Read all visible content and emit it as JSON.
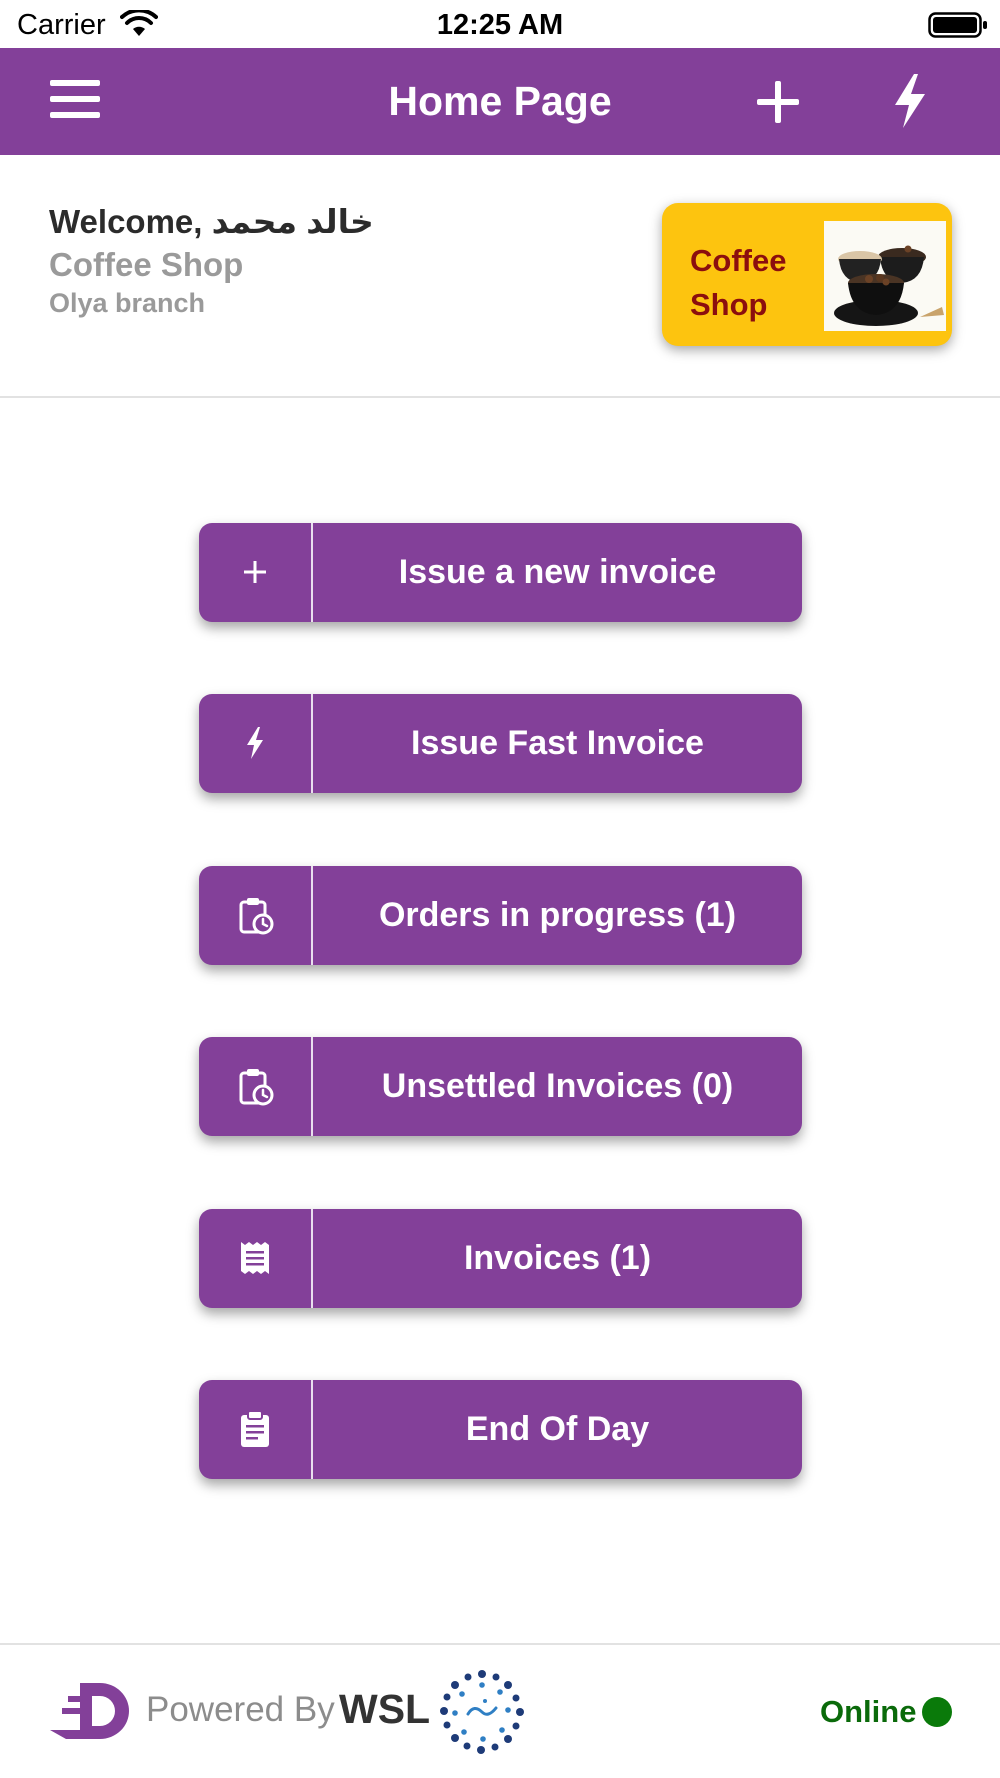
{
  "status_bar": {
    "carrier": "Carrier",
    "time": "12:25 AM",
    "icons": [
      "wifi-icon",
      "battery-icon"
    ]
  },
  "nav_bar": {
    "title": "Home Page",
    "icons": [
      "menu-icon",
      "add-icon",
      "flash-icon"
    ],
    "background_color": "#834099"
  },
  "welcome": {
    "greeting": "Welcome, خالد محمد",
    "shop_name": "Coffee Shop",
    "branch": "Olya branch"
  },
  "shop_logo": {
    "text": "Coffee\nShop",
    "background_color": "#fdc40f",
    "text_color": "#8b0e0e",
    "image": "coffee-cups-image"
  },
  "actions": [
    {
      "label": "Issue a new invoice",
      "icon": "plus-icon"
    },
    {
      "label": "Issue Fast Invoice",
      "icon": "flash-icon"
    },
    {
      "label": "Orders in progress (1)",
      "icon": "clipboard-clock-icon"
    },
    {
      "label": "Unsettled Invoices (0)",
      "icon": "clipboard-clock-icon"
    },
    {
      "label": "Invoices (1)",
      "icon": "receipt-icon"
    },
    {
      "label": "End Of Day",
      "icon": "clipboard-list-icon"
    }
  ],
  "footer": {
    "powered_by": "Powered By",
    "brand": "WSL",
    "status": "Online",
    "status_color": "#0a7a0a",
    "icons": [
      "d-logo-icon",
      "wsl-logo-icon"
    ]
  }
}
